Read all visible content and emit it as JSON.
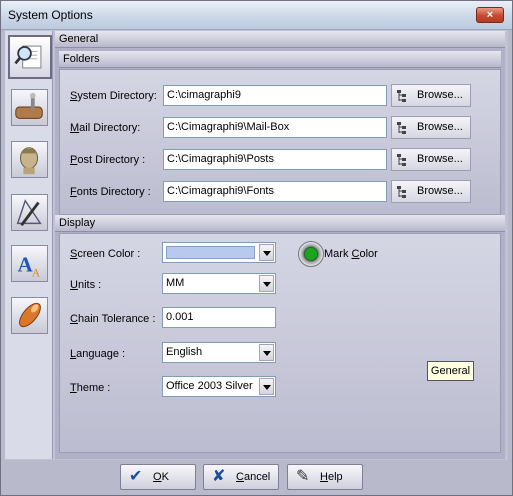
{
  "window": {
    "title": "System Options",
    "close_label": "×"
  },
  "sidebar": {
    "items": [
      {
        "icon": "magnifier-document-icon",
        "active": true
      },
      {
        "icon": "wood-tool-icon"
      },
      {
        "icon": "statue-head-icon"
      },
      {
        "icon": "pen-drawing-icon"
      },
      {
        "icon": "font-letters-icon"
      },
      {
        "icon": "brush-icon"
      }
    ]
  },
  "sections": {
    "general": "General",
    "folders": "Folders",
    "display": "Display"
  },
  "folders": {
    "system": {
      "label_u": "S",
      "label_rest": "ystem Directory:",
      "value": "C:\\cimagraphi9",
      "browse": "Browse..."
    },
    "mail": {
      "label_u": "M",
      "label_rest": "ail Directory:",
      "value": "C:\\Cimagraphi9\\Mail-Box",
      "browse": "Browse..."
    },
    "post": {
      "label_u": "P",
      "label_rest": "ost Directory :",
      "value": "C:\\Cimagraphi9\\Posts",
      "browse": "Browse..."
    },
    "fonts": {
      "label_u": "F",
      "label_rest": "onts Directory :",
      "value": "C:\\Cimagraphi9\\Fonts",
      "browse": "Browse..."
    }
  },
  "display": {
    "screen_color": {
      "label_u": "S",
      "label_rest": "creen Color :",
      "color": "#b7c9ec"
    },
    "mark_color": {
      "label_pre": "Mark ",
      "label_u": "C",
      "label_rest": "olor",
      "color": "#19a61c"
    },
    "units": {
      "label_u": "U",
      "label_rest": "nits :",
      "value": "MM"
    },
    "chain_tolerance": {
      "label_u": "C",
      "label_rest": "hain Tolerance :",
      "value": "0.001"
    },
    "language": {
      "label_u": "L",
      "label_rest": "anguage :",
      "value": "English"
    },
    "theme": {
      "label_u": "T",
      "label_rest": "heme :",
      "value": "Office 2003 Silver"
    }
  },
  "tooltip": "General",
  "footer": {
    "ok": {
      "u": "O",
      "rest": "K"
    },
    "cancel": {
      "u": "C",
      "rest": "ancel"
    },
    "help": {
      "u": "H",
      "rest": "elp"
    }
  }
}
